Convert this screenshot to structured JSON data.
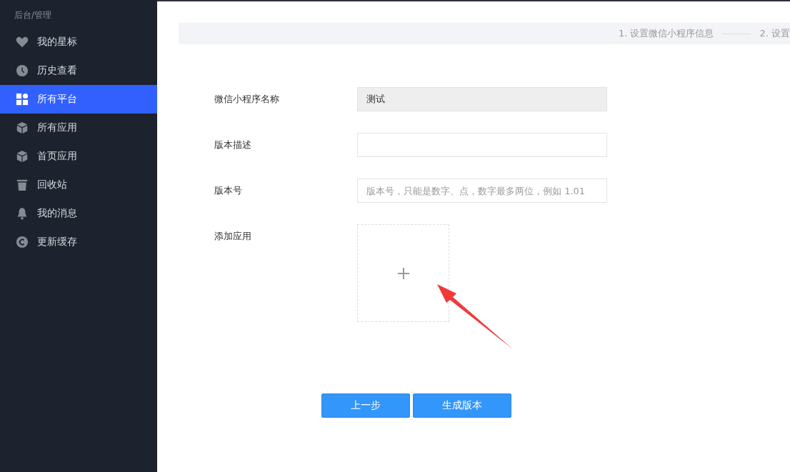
{
  "sidebar": {
    "breadcrumb": "后台/管理",
    "items": [
      {
        "label": "我的星标",
        "selected": false
      },
      {
        "label": "历史查看",
        "selected": false
      },
      {
        "label": "所有平台",
        "selected": true
      },
      {
        "label": "所有应用",
        "selected": false
      },
      {
        "label": "首页应用",
        "selected": false
      },
      {
        "label": "回收站",
        "selected": false
      },
      {
        "label": "我的消息",
        "selected": false
      },
      {
        "label": "更新缓存",
        "selected": false
      }
    ]
  },
  "steps": [
    {
      "label": "1. 设置微信小程序信息"
    },
    {
      "label": "2. 设置"
    }
  ],
  "form": {
    "fields": [
      {
        "label": "微信小程序名称",
        "value": "测试",
        "disabled": true
      },
      {
        "label": "版本描述",
        "disabled": false
      },
      {
        "label": "版本号",
        "placeholder": "版本号，只能是数字、点，数字最多两位，例如 1.01",
        "disabled": false
      }
    ],
    "upload_label": "添加应用"
  },
  "buttons": [
    {
      "label": "上一步"
    },
    {
      "label": "生成版本"
    }
  ]
}
